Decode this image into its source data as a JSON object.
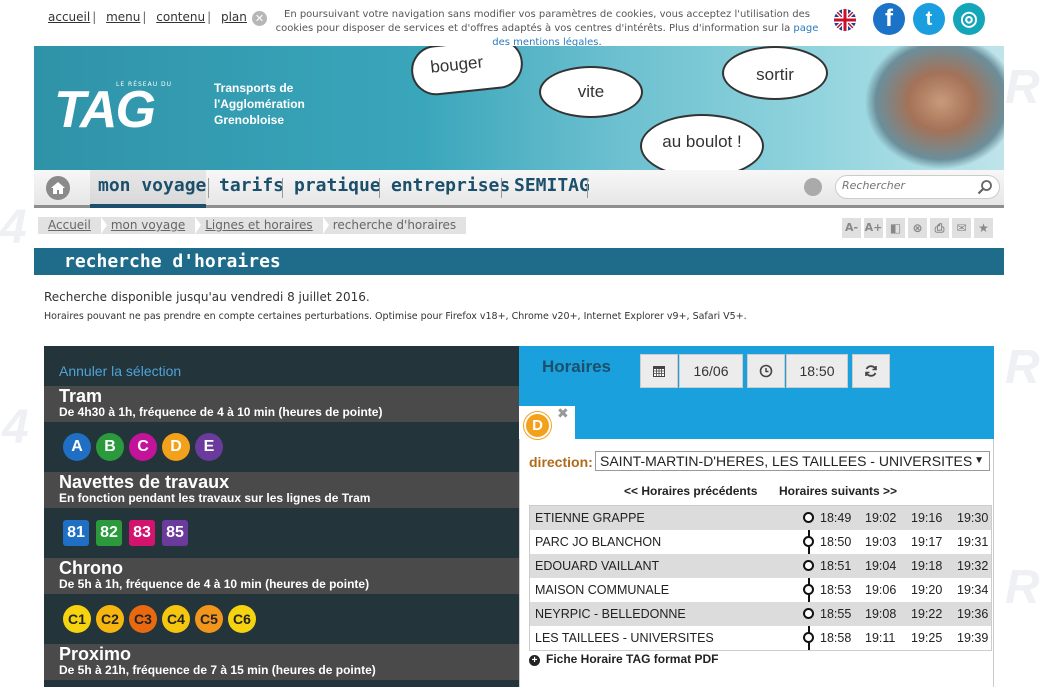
{
  "access": {
    "items": [
      "accueil",
      "menu",
      "contenu",
      "plan"
    ]
  },
  "cookie": {
    "text": "En poursuivant votre navigation sans modifier vos paramètres de cookies, vous acceptez l'utilisation des cookies pour disposer de services et d'offres adaptés à vos centres d'intérêts. Plus d'information sur la",
    "link": "page des mentions légales",
    "end": "."
  },
  "social": {
    "facebook": "f",
    "twitter": "t",
    "instagram": "◎"
  },
  "banner": {
    "logo": "TAG",
    "logo_small": "LE RÉSEAU DU",
    "sub1": "Transports de",
    "sub2": "l'Agglomération",
    "sub3": "Grenobloise",
    "bubbles": [
      "bouger",
      "vite",
      "sortir",
      "au boulot !"
    ]
  },
  "nav": {
    "items": [
      "mon voyage",
      "tarifs",
      "pratique",
      "entreprises",
      "SEMITAG"
    ],
    "search_placeholder": "Rechercher"
  },
  "breadcrumb": [
    "Accueil",
    "mon voyage",
    "Lignes et horaires",
    "recherche d'horaires"
  ],
  "tools": [
    "A-",
    "A+",
    "◧",
    "⊗",
    "⎙",
    "✉",
    "★"
  ],
  "page_title": "recherche d'horaires",
  "info1": "Recherche disponible jusqu'au vendredi 8 juillet 2016.",
  "info2": "Horaires pouvant ne pas prendre en compte certaines perturbations. Optimise pour Firefox v18+, Chrome v20+, Internet Explorer v9+, Safari V5+.",
  "left": {
    "cancel": "Annuler la sélection",
    "categories": [
      {
        "name": "Tram",
        "desc": "De 4h30 à 1h, fréquence de 4 à 10 min (heures de pointe)"
      },
      {
        "name": "Navettes de travaux",
        "desc": "En fonction pendant les travaux sur les lignes de Tram"
      },
      {
        "name": "Chrono",
        "desc": "De 5h à 1h, fréquence de 4 à 10 min (heures de pointe)"
      },
      {
        "name": "Proximo",
        "desc": "De 5h à 21h, fréquence de 7 à 15 min (heures de pointe)"
      }
    ],
    "tram_lines": [
      {
        "label": "A",
        "color": "#1f6fc4"
      },
      {
        "label": "B",
        "color": "#2a9a3c"
      },
      {
        "label": "C",
        "color": "#c3139b"
      },
      {
        "label": "D",
        "color": "#f3a11a"
      },
      {
        "label": "E",
        "color": "#6a3a9c"
      }
    ],
    "navette_lines": [
      {
        "label": "81",
        "color": "#1f6fc4"
      },
      {
        "label": "82",
        "color": "#2a9a3c"
      },
      {
        "label": "83",
        "color": "#d4136f"
      },
      {
        "label": "85",
        "color": "#6a3a9c"
      }
    ],
    "chrono_lines": [
      {
        "label": "C1",
        "color": "#f5d40f"
      },
      {
        "label": "C2",
        "color": "#f7b60f"
      },
      {
        "label": "C3",
        "color": "#e8690f"
      },
      {
        "label": "C4",
        "color": "#f5c60f"
      },
      {
        "label": "C5",
        "color": "#f2951b"
      },
      {
        "label": "C6",
        "color": "#f5d40f"
      }
    ]
  },
  "right": {
    "title": "Horaires",
    "date": "16/06",
    "time": "18:50",
    "line": "D",
    "direction_label": "direction:",
    "direction": "SAINT-MARTIN-D'HERES, LES TAILLEES - UNIVERSITES",
    "prev": "<< Horaires précédents",
    "next": "Horaires suivants >>",
    "rows": [
      {
        "stop": "ETIENNE GRAPPE",
        "times": [
          "18:49",
          "19:02",
          "19:16",
          "19:30"
        ]
      },
      {
        "stop": "PARC JO BLANCHON",
        "times": [
          "18:50",
          "19:03",
          "19:17",
          "19:31"
        ]
      },
      {
        "stop": "EDOUARD VAILLANT",
        "times": [
          "18:51",
          "19:04",
          "19:18",
          "19:32"
        ]
      },
      {
        "stop": "MAISON COMMUNALE",
        "times": [
          "18:53",
          "19:06",
          "19:20",
          "19:34"
        ]
      },
      {
        "stop": "NEYRPIC - BELLEDONNE",
        "times": [
          "18:55",
          "19:08",
          "19:22",
          "19:36"
        ]
      },
      {
        "stop": "LES TAILLEES - UNIVERSITES",
        "times": [
          "18:58",
          "19:11",
          "19:25",
          "19:39"
        ]
      }
    ],
    "pdf": "Fiche Horaire TAG format PDF"
  }
}
